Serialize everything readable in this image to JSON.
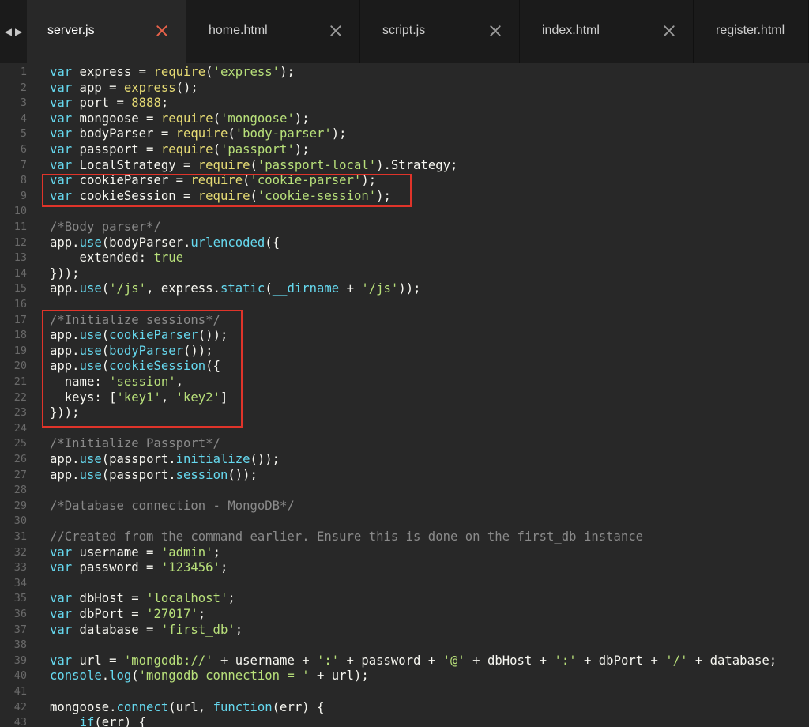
{
  "tabs": [
    {
      "label": "server.js",
      "active": true
    },
    {
      "label": "home.html",
      "active": false
    },
    {
      "label": "script.js",
      "active": false
    },
    {
      "label": "index.html",
      "active": false
    },
    {
      "label": "register.html",
      "active": false
    }
  ],
  "nav": {
    "back_glyph": "◀",
    "forward_glyph": "▶"
  },
  "lines": [
    [
      [
        "kw",
        "var"
      ],
      [
        "pl",
        " express = "
      ],
      [
        "fn",
        "require"
      ],
      [
        "pl",
        "("
      ],
      [
        "str",
        "'express'"
      ],
      [
        "pl",
        ");"
      ]
    ],
    [
      [
        "kw",
        "var"
      ],
      [
        "pl",
        " app = "
      ],
      [
        "fn",
        "express"
      ],
      [
        "pl",
        "();"
      ]
    ],
    [
      [
        "kw",
        "var"
      ],
      [
        "pl",
        " port = "
      ],
      [
        "num",
        "8888"
      ],
      [
        "pl",
        ";"
      ]
    ],
    [
      [
        "kw",
        "var"
      ],
      [
        "pl",
        " mongoose = "
      ],
      [
        "fn",
        "require"
      ],
      [
        "pl",
        "("
      ],
      [
        "str",
        "'mongoose'"
      ],
      [
        "pl",
        ");"
      ]
    ],
    [
      [
        "kw",
        "var"
      ],
      [
        "pl",
        " bodyParser = "
      ],
      [
        "fn",
        "require"
      ],
      [
        "pl",
        "("
      ],
      [
        "str",
        "'body-parser'"
      ],
      [
        "pl",
        ");"
      ]
    ],
    [
      [
        "kw",
        "var"
      ],
      [
        "pl",
        " passport = "
      ],
      [
        "fn",
        "require"
      ],
      [
        "pl",
        "("
      ],
      [
        "str",
        "'passport'"
      ],
      [
        "pl",
        ");"
      ]
    ],
    [
      [
        "kw",
        "var"
      ],
      [
        "pl",
        " LocalStrategy = "
      ],
      [
        "fn",
        "require"
      ],
      [
        "pl",
        "("
      ],
      [
        "str",
        "'passport-local'"
      ],
      [
        "pl",
        ").Strategy;"
      ]
    ],
    [
      [
        "kw",
        "var"
      ],
      [
        "pl",
        " cookieParser = "
      ],
      [
        "fn",
        "require"
      ],
      [
        "pl",
        "("
      ],
      [
        "str",
        "'cookie-parser'"
      ],
      [
        "pl",
        ");"
      ]
    ],
    [
      [
        "kw",
        "var"
      ],
      [
        "pl",
        " cookieSession = "
      ],
      [
        "fn",
        "require"
      ],
      [
        "pl",
        "("
      ],
      [
        "str",
        "'cookie-session'"
      ],
      [
        "pl",
        ");"
      ]
    ],
    [],
    [
      [
        "cm",
        "/*Body parser*/"
      ]
    ],
    [
      [
        "pl",
        "app."
      ],
      [
        "kw",
        "use"
      ],
      [
        "pl",
        "(bodyParser."
      ],
      [
        "kw",
        "urlencoded"
      ],
      [
        "pl",
        "({"
      ]
    ],
    [
      [
        "pl",
        "    extended: "
      ],
      [
        "bool",
        "true"
      ]
    ],
    [
      [
        "pl",
        "}));"
      ]
    ],
    [
      [
        "pl",
        "app."
      ],
      [
        "kw",
        "use"
      ],
      [
        "pl",
        "("
      ],
      [
        "str",
        "'/js'"
      ],
      [
        "pl",
        ", express."
      ],
      [
        "kw",
        "static"
      ],
      [
        "pl",
        "("
      ],
      [
        "kw",
        "__dirname"
      ],
      [
        "pl",
        " + "
      ],
      [
        "str",
        "'/js'"
      ],
      [
        "pl",
        "));"
      ]
    ],
    [],
    [
      [
        "cm",
        "/*Initialize sessions*/"
      ]
    ],
    [
      [
        "pl",
        "app."
      ],
      [
        "kw",
        "use"
      ],
      [
        "pl",
        "("
      ],
      [
        "kw",
        "cookieParser"
      ],
      [
        "pl",
        "());"
      ]
    ],
    [
      [
        "pl",
        "app."
      ],
      [
        "kw",
        "use"
      ],
      [
        "pl",
        "("
      ],
      [
        "kw",
        "bodyParser"
      ],
      [
        "pl",
        "());"
      ]
    ],
    [
      [
        "pl",
        "app."
      ],
      [
        "kw",
        "use"
      ],
      [
        "pl",
        "("
      ],
      [
        "kw",
        "cookieSession"
      ],
      [
        "pl",
        "({"
      ]
    ],
    [
      [
        "pl",
        "  name: "
      ],
      [
        "str",
        "'session'"
      ],
      [
        "pl",
        ","
      ]
    ],
    [
      [
        "pl",
        "  keys: ["
      ],
      [
        "str",
        "'key1'"
      ],
      [
        "pl",
        ", "
      ],
      [
        "str",
        "'key2'"
      ],
      [
        "pl",
        "]"
      ]
    ],
    [
      [
        "pl",
        "}));"
      ]
    ],
    [],
    [
      [
        "cm",
        "/*Initialize Passport*/"
      ]
    ],
    [
      [
        "pl",
        "app."
      ],
      [
        "kw",
        "use"
      ],
      [
        "pl",
        "(passport."
      ],
      [
        "kw",
        "initialize"
      ],
      [
        "pl",
        "());"
      ]
    ],
    [
      [
        "pl",
        "app."
      ],
      [
        "kw",
        "use"
      ],
      [
        "pl",
        "(passport."
      ],
      [
        "kw",
        "session"
      ],
      [
        "pl",
        "());"
      ]
    ],
    [],
    [
      [
        "cm",
        "/*Database connection - MongoDB*/"
      ]
    ],
    [],
    [
      [
        "cm",
        "//Created from the command earlier. Ensure this is done on the first_db instance"
      ]
    ],
    [
      [
        "kw",
        "var"
      ],
      [
        "pl",
        " username = "
      ],
      [
        "str",
        "'admin'"
      ],
      [
        "pl",
        ";"
      ]
    ],
    [
      [
        "kw",
        "var"
      ],
      [
        "pl",
        " password = "
      ],
      [
        "str",
        "'123456'"
      ],
      [
        "pl",
        ";"
      ]
    ],
    [],
    [
      [
        "kw",
        "var"
      ],
      [
        "pl",
        " dbHost = "
      ],
      [
        "str",
        "'localhost'"
      ],
      [
        "pl",
        ";"
      ]
    ],
    [
      [
        "kw",
        "var"
      ],
      [
        "pl",
        " dbPort = "
      ],
      [
        "str",
        "'27017'"
      ],
      [
        "pl",
        ";"
      ]
    ],
    [
      [
        "kw",
        "var"
      ],
      [
        "pl",
        " database = "
      ],
      [
        "str",
        "'first_db'"
      ],
      [
        "pl",
        ";"
      ]
    ],
    [],
    [
      [
        "kw",
        "var"
      ],
      [
        "pl",
        " url = "
      ],
      [
        "str",
        "'mongodb://'"
      ],
      [
        "pl",
        " + username + "
      ],
      [
        "str",
        "':'"
      ],
      [
        "pl",
        " + password + "
      ],
      [
        "str",
        "'@'"
      ],
      [
        "pl",
        " + dbHost + "
      ],
      [
        "str",
        "':'"
      ],
      [
        "pl",
        " + dbPort + "
      ],
      [
        "str",
        "'/'"
      ],
      [
        "pl",
        " + database;"
      ]
    ],
    [
      [
        "kw",
        "console"
      ],
      [
        "pl",
        "."
      ],
      [
        "kw",
        "log"
      ],
      [
        "pl",
        "("
      ],
      [
        "str",
        "'mongodb connection = '"
      ],
      [
        "pl",
        " + url);"
      ]
    ],
    [],
    [
      [
        "pl",
        "mongoose."
      ],
      [
        "kw",
        "connect"
      ],
      [
        "pl",
        "(url, "
      ],
      [
        "kw",
        "function"
      ],
      [
        "pl",
        "(err) {"
      ]
    ],
    [
      [
        "pl",
        "    "
      ],
      [
        "kw",
        "if"
      ],
      [
        "pl",
        "(err) {"
      ]
    ]
  ]
}
